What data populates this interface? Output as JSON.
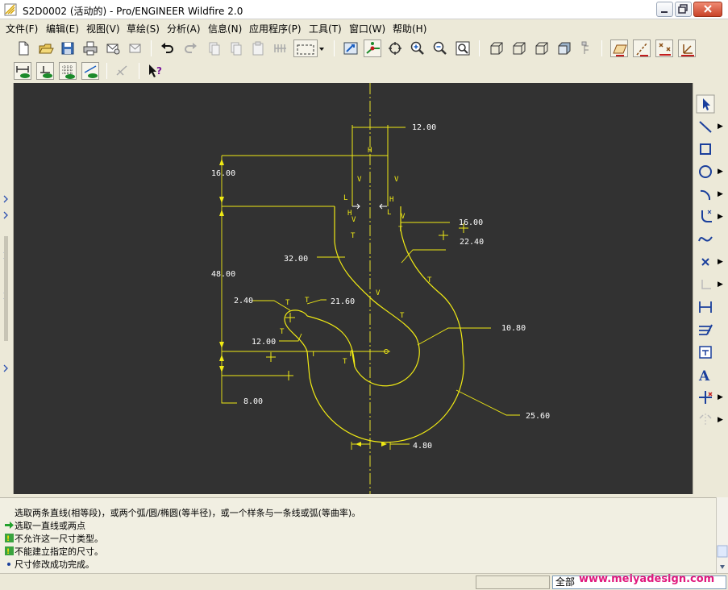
{
  "window": {
    "title": "S2D0002 (活动的) - Pro/ENGINEER Wildfire 2.0",
    "controls": [
      "minimize",
      "maximize",
      "close"
    ]
  },
  "menubar": {
    "items": [
      {
        "label": "文件(F)",
        "id": "file"
      },
      {
        "label": "编辑(E)",
        "id": "edit"
      },
      {
        "label": "视图(V)",
        "id": "view"
      },
      {
        "label": "草绘(S)",
        "id": "sketch"
      },
      {
        "label": "分析(A)",
        "id": "analysis"
      },
      {
        "label": "信息(N)",
        "id": "info"
      },
      {
        "label": "应用程序(P)",
        "id": "applications"
      },
      {
        "label": "工具(T)",
        "id": "tools"
      },
      {
        "label": "窗口(W)",
        "id": "window"
      },
      {
        "label": "帮助(H)",
        "id": "help"
      }
    ]
  },
  "toolbar_icons": {
    "row1": [
      "new-icon",
      "open-icon",
      "save-icon",
      "print-icon",
      "email-icon",
      "email-link-icon",
      "undo-icon",
      "redo-icon",
      "cut-icon",
      "copy-icon",
      "paste-icon",
      "paste-special-icon",
      "regenerate-icon",
      "selection-box-icon",
      "dropdown-icon",
      "sketch-view-icon",
      "display-entities-icon",
      "repaint-icon",
      "zoom-in-icon",
      "zoom-out-icon",
      "refit-icon",
      "wireframe-icon",
      "hidden-line-icon",
      "no-hidden-icon",
      "shading-icon",
      "model-tree-icon",
      "datum-planes-icon",
      "datum-axes-icon",
      "datum-points-icon",
      "coord-systems-icon"
    ],
    "row2": [
      "display-dimensions-icon",
      "display-constraints-icon",
      "display-grid-icon",
      "display-vertices-icon",
      "sketch-diagnostics-icon",
      "whats-this-icon"
    ]
  },
  "sketcher_tools": [
    "select-icon",
    "line-icon",
    "rectangle-icon",
    "circle-icon",
    "arc-icon",
    "fillet-icon",
    "spline-icon",
    "point-icon",
    "coord-system-icon",
    "dimension-icon",
    "modify-icon",
    "constraints-icon",
    "text-icon",
    "palette-icon",
    "trim-icon",
    "mirror-icon"
  ],
  "sketch": {
    "dimensions": [
      "12.00",
      "16.00",
      "16.00",
      "22.40",
      "32.00",
      "48.00",
      "2.40",
      "21.60",
      "12.00",
      "10.80",
      "8.00",
      "25.60",
      "4.80"
    ],
    "constraint_symbols": [
      "H",
      "V",
      "V",
      "L",
      "H",
      "L",
      "H",
      "V",
      "V",
      "T",
      "T",
      "T",
      "T",
      "V",
      "T",
      "T",
      "T",
      "T",
      "T",
      "T"
    ],
    "line_color": "#f0ea14",
    "centerline_color": "#e6de2a",
    "background_color": "#323232"
  },
  "messages": [
    {
      "text": "选取两条直线(相等段)，或两个弧/圆/椭圆(等半径)，或一个样条与一条线或弧(等曲率)。",
      "icon": "none"
    },
    {
      "text": "选取一直线或两点",
      "icon": "arrow-icon"
    },
    {
      "text": "不允许这一尺寸类型。",
      "icon": "warning-icon"
    },
    {
      "text": "不能建立指定的尺寸。",
      "icon": "warning-icon"
    },
    {
      "text": "尺寸修改成功完成。",
      "icon": "bullet-icon"
    }
  ],
  "status": {
    "filter_value": "全部",
    "watermark": "www.meiyadesign.com"
  },
  "colors": {
    "chrome": "#ece9d8",
    "canvas": "#323232",
    "sketch_yellow": "#f0ea14",
    "watermark": "#e0197d"
  }
}
